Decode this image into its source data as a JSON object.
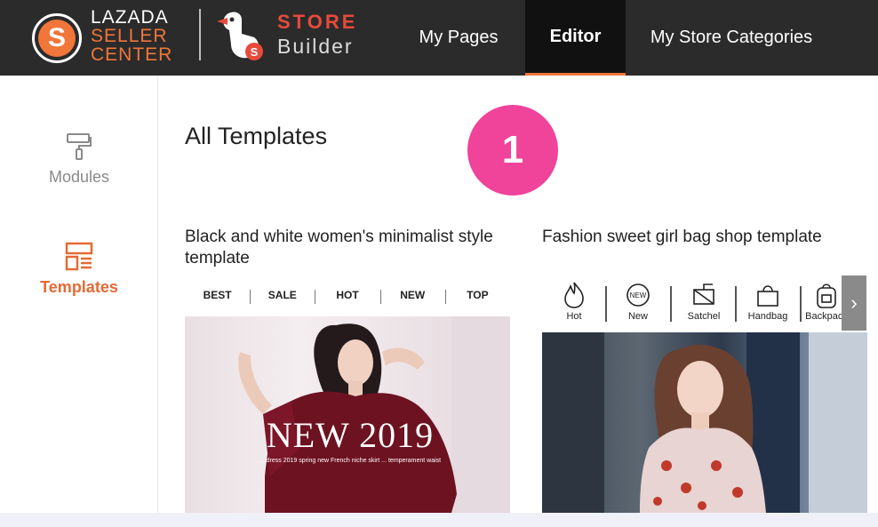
{
  "brand": {
    "lazada_line1": "LAZADA",
    "lazada_line2": "SELLER",
    "lazada_line3": "CENTER",
    "lazada_mark": "S",
    "store_line1": "STORE",
    "store_line2": "Builder",
    "accent_color": "#f0763a"
  },
  "nav": {
    "items": [
      {
        "label": "My Pages"
      },
      {
        "label": "Editor",
        "active": true
      },
      {
        "label": "My Store Categories"
      }
    ]
  },
  "sidebar": {
    "items": [
      {
        "label": "Modules",
        "icon": "paint-roller-icon"
      },
      {
        "label": "Templates",
        "icon": "templates-layout-icon",
        "active": true
      }
    ]
  },
  "main": {
    "title": "All Templates",
    "step_badge": "1",
    "templates": [
      {
        "title": "Black and white women's minimalist style template",
        "nav_tabs": [
          "BEST",
          "SALE",
          "HOT",
          "NEW",
          "TOP"
        ],
        "banner_text": "NEW 2019",
        "banner_subtext": "... dress 2019 spring new French niche skirt ... temperament waist"
      },
      {
        "title": "Fashion sweet girl bag shop template",
        "categories": [
          {
            "label": "Hot",
            "icon": "flame-icon"
          },
          {
            "label": "New",
            "icon": "new-badge-icon"
          },
          {
            "label": "Satchel",
            "icon": "satchel-icon"
          },
          {
            "label": "Handbag",
            "icon": "handbag-icon"
          },
          {
            "label": "Backpack",
            "icon": "backpack-icon"
          }
        ],
        "next_arrow": "›"
      }
    ]
  }
}
